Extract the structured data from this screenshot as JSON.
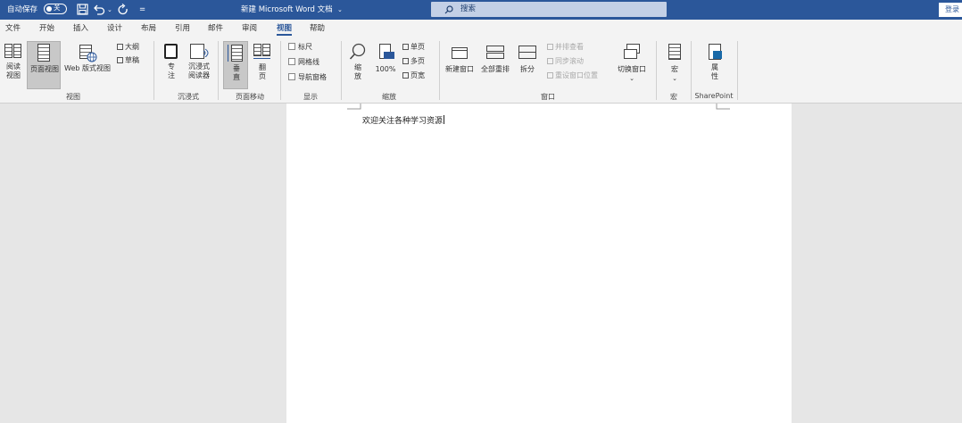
{
  "titlebar": {
    "autosave_label": "自动保存",
    "autosave_state": "关",
    "doc_title": "新建 Microsoft Word 文档",
    "search_placeholder": "搜索",
    "login_label": "登录",
    "qat_arrow": "⌄",
    "qat_customize": "=",
    "title_arrow": "⌄"
  },
  "tabs": [
    "文件",
    "开始",
    "插入",
    "设计",
    "布局",
    "引用",
    "邮件",
    "审阅",
    "视图",
    "帮助"
  ],
  "active_tab": "视图",
  "ribbon": {
    "views": {
      "read_mode": "阅读\n视图",
      "print_layout": "页面视图",
      "web_layout": "Web 版式视图",
      "outline": "大纲",
      "draft": "草稿",
      "group": "视图"
    },
    "immersive": {
      "focus": "专\n注",
      "reader": "沉浸式\n阅读器",
      "group": "沉浸式"
    },
    "page_movement": {
      "vertical": "垂\n直",
      "side_to_side": "翻\n页",
      "group": "页面移动"
    },
    "show": {
      "ruler": "标尺",
      "gridlines": "网格线",
      "navigation": "导航窗格",
      "group": "显示"
    },
    "zoom": {
      "zoom": "缩\n放",
      "percent": "100%",
      "one_page": "单页",
      "multiple_pages": "多页",
      "page_width": "页宽",
      "group": "缩放"
    },
    "window": {
      "new_window": "新建窗口",
      "arrange_all": "全部重排",
      "split": "拆分",
      "side_by_side": "并排查看",
      "sync_scroll": "同步滚动",
      "reset_position": "重设窗口位置",
      "switch_windows": "切换窗口",
      "group": "窗口"
    },
    "macros": {
      "macros": "宏",
      "group": "宏"
    },
    "sharepoint": {
      "properties": "属\n性",
      "group": "SharePoint"
    }
  },
  "document": {
    "text": "欢迎关注各种学习资源"
  },
  "colors": {
    "titlebar": "#2b579a",
    "ribbon": "#f3f3f3",
    "canvas": "#e6e6e6",
    "page": "#ffffff"
  }
}
